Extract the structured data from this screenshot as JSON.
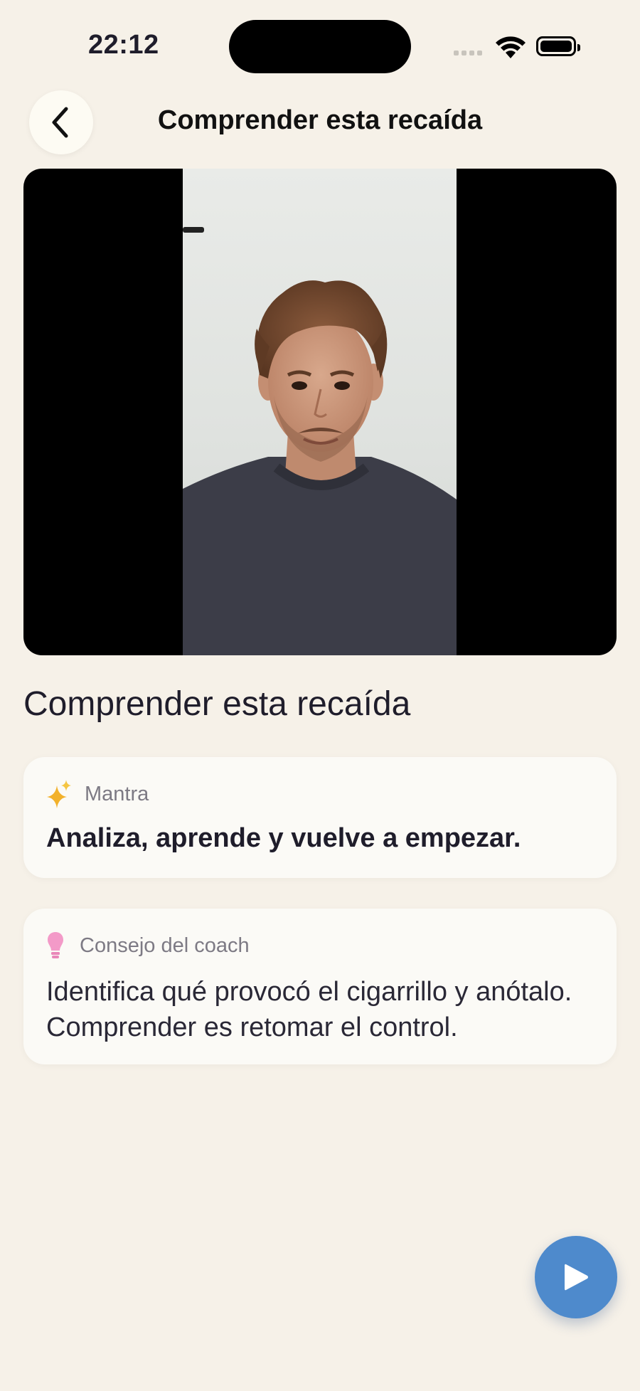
{
  "status_bar": {
    "time": "22:12",
    "icons": [
      "cellular-signal-icon",
      "wifi-icon",
      "battery-icon"
    ]
  },
  "header": {
    "back_icon": "chevron-left-icon",
    "title": "Comprender esta recaída"
  },
  "video": {
    "description_icon": "video-frame"
  },
  "content": {
    "title": "Comprender esta recaída",
    "mantra": {
      "icon": "sparkles-icon",
      "label": "Mantra",
      "text": "Analiza, aprende y vuelve a empezar."
    },
    "coach_tip": {
      "icon": "lightbulb-icon",
      "label": "Consejo del coach",
      "text": "Identifica qué provocó el cigarrillo y anótalo. Comprender es retomar el control."
    }
  },
  "play_button": {
    "icon": "play-icon"
  },
  "colors": {
    "background": "#f6f1e8",
    "card": "#fbfaf6",
    "accent_blue": "#4e8acc",
    "sparkle_yellow": "#f2b12b",
    "bulb_pink": "#f39ac8",
    "text_dark": "#1f1d2b",
    "text_muted": "#7d7a84"
  }
}
